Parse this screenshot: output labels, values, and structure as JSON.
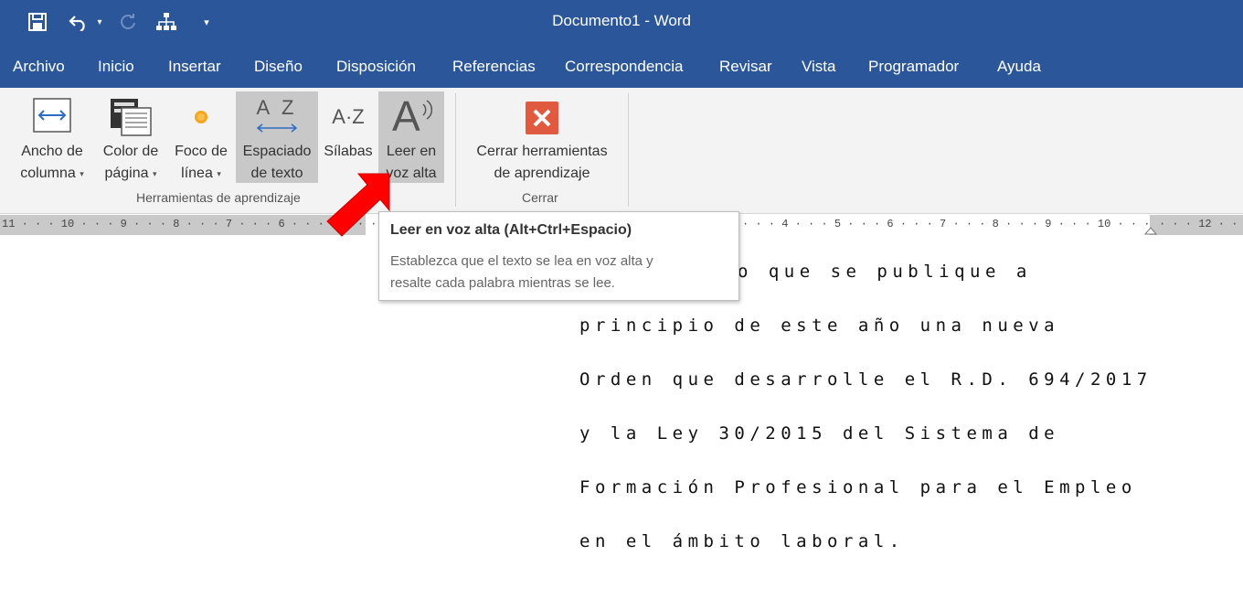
{
  "window": {
    "title": "Documento1  -  Word"
  },
  "quick_access": {
    "save_icon": "save-icon",
    "undo_icon": "undo-icon",
    "redo_icon": "redo-icon",
    "customize_icon": "customize-qat-icon"
  },
  "tabs": [
    {
      "label": "Archivo"
    },
    {
      "label": "Inicio"
    },
    {
      "label": "Insertar"
    },
    {
      "label": "Diseño"
    },
    {
      "label": "Disposición"
    },
    {
      "label": "Referencias"
    },
    {
      "label": "Correspondencia"
    },
    {
      "label": "Revisar"
    },
    {
      "label": "Vista"
    },
    {
      "label": "Programador"
    },
    {
      "label": "Ayuda"
    }
  ],
  "ribbon": {
    "groups": [
      {
        "label": "Herramientas de aprendizaje",
        "buttons": [
          {
            "line1": "Ancho de",
            "line2": "columna",
            "dropdown": "▾",
            "icon": "column-width-icon"
          },
          {
            "line1": "Color de",
            "line2": "página",
            "dropdown": "▾",
            "icon": "page-color-icon"
          },
          {
            "line1": "Foco de",
            "line2": "línea",
            "dropdown": "▾",
            "icon": "line-focus-icon"
          },
          {
            "line1": "Espaciado",
            "line2": "de texto",
            "icon": "text-spacing-icon",
            "icon_text": "A Z"
          },
          {
            "line1": "Sílabas",
            "line2": "",
            "icon": "syllables-icon",
            "icon_text": "A·Z"
          },
          {
            "line1": "Leer en",
            "line2": "voz alta",
            "icon": "read-aloud-icon",
            "icon_text": "A"
          }
        ]
      },
      {
        "label": "Cerrar",
        "buttons": [
          {
            "line1": "Cerrar herramientas",
            "line2": "de aprendizaje",
            "icon": "close-learning-tools-icon"
          }
        ]
      }
    ]
  },
  "ruler": {
    "left": "11 · · · 10 · · · 9 · · · 8 · · · 7 · · · 6 · · · 5 · · · 4",
    "right": "· · · 4 · · · 5 · · · 6 · · · 7 · · · 8 · · · 9 · · · 10 · · ·",
    "far_right": "· · · 12 · ·"
  },
  "tooltip": {
    "title": "Leer en voz alta (Alt+Ctrl+Espacio)",
    "line1": "Establezca que el texto se lea en voz alta y",
    "line2": "resalte cada palabra mientras se lee."
  },
  "document": {
    "lines": [
      "to que se publique a",
      "principio de este año una nueva",
      "Orden que desarrolle el R.D. 694/2017",
      "y la Ley 30/2015 del Sistema de",
      "Formación Profesional para el Empleo",
      "en el ámbito laboral."
    ]
  },
  "colors": {
    "titlebar": "#2b579a",
    "ribbon": "#f3f3f3",
    "active_button": "#c8c8c8",
    "arrow": "#ff0000",
    "close_button": "#e05a3f"
  }
}
